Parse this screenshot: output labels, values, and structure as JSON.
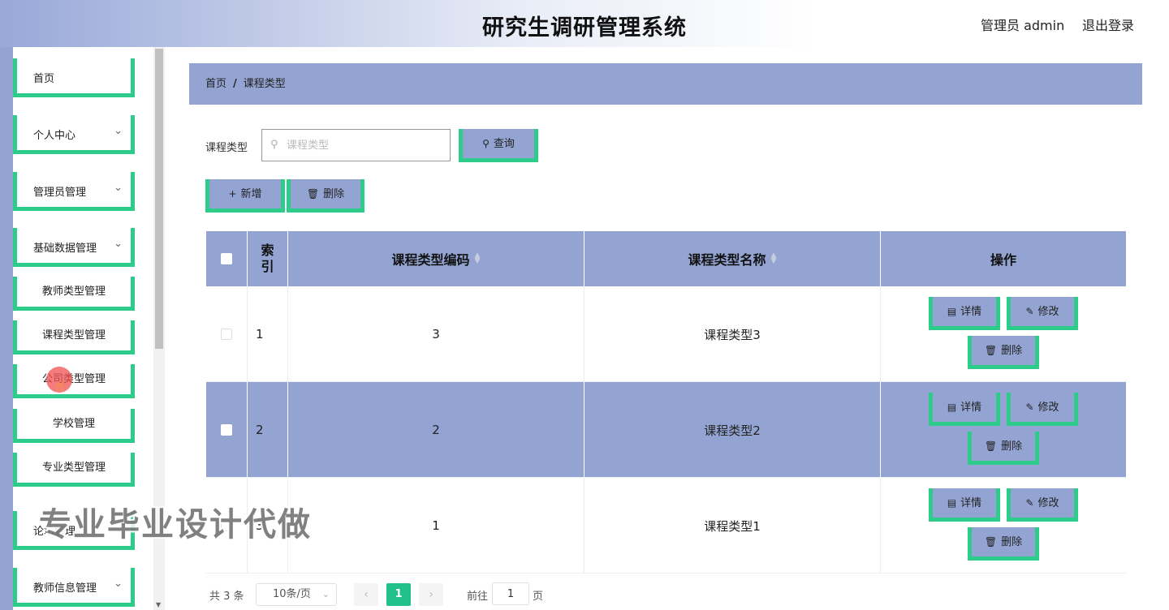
{
  "header": {
    "title": "研究生调研管理系统",
    "user": "管理员 admin",
    "logout": "退出登录"
  },
  "sidebar": {
    "items": [
      {
        "label": "首页",
        "expandable": false
      },
      {
        "label": "个人中心",
        "expandable": true
      },
      {
        "label": "管理员管理",
        "expandable": true
      },
      {
        "label": "基础数据管理",
        "expandable": true
      }
    ],
    "subitems": [
      "教师类型管理",
      "课程类型管理",
      "公司类型管理",
      "学校管理",
      "专业类型管理"
    ],
    "items_after": [
      {
        "label": "论坛管理",
        "expandable": false
      },
      {
        "label": "教师信息管理",
        "expandable": true
      }
    ]
  },
  "breadcrumb": {
    "home": "首页",
    "sep": "/",
    "current": "课程类型"
  },
  "search": {
    "label": "课程类型",
    "placeholder": "课程类型",
    "value": "",
    "button": "查询"
  },
  "toolbar": {
    "add": "新增",
    "delete": "删除"
  },
  "table": {
    "columns": [
      "索引",
      "课程类型编码",
      "课程类型名称",
      "操作"
    ],
    "index_col": [
      "索",
      "引"
    ],
    "rows": [
      {
        "index": "1",
        "code": "3",
        "name": "课程类型3"
      },
      {
        "index": "2",
        "code": "2",
        "name": "课程类型2"
      },
      {
        "index": "3",
        "code": "1",
        "name": "课程类型1"
      }
    ],
    "actions": {
      "detail": "详情",
      "edit": "修改",
      "delete": "删除"
    }
  },
  "pagination": {
    "total": "共 3 条",
    "page_size": "10条/页",
    "current_page": "1",
    "goto_label": "前往",
    "goto_value": "1",
    "page_suffix": "页"
  },
  "watermark": "专业毕业设计代做",
  "icons": {
    "search": "search-icon",
    "plus": "plus-icon",
    "trash": "trash-icon",
    "doc": "document-icon",
    "edit": "pencil-icon",
    "chevron": "chevron-down-icon"
  },
  "colors": {
    "accent_green": "#2ecc8a",
    "panel_blue": "#93a4d2",
    "page_active": "#22c08a"
  }
}
